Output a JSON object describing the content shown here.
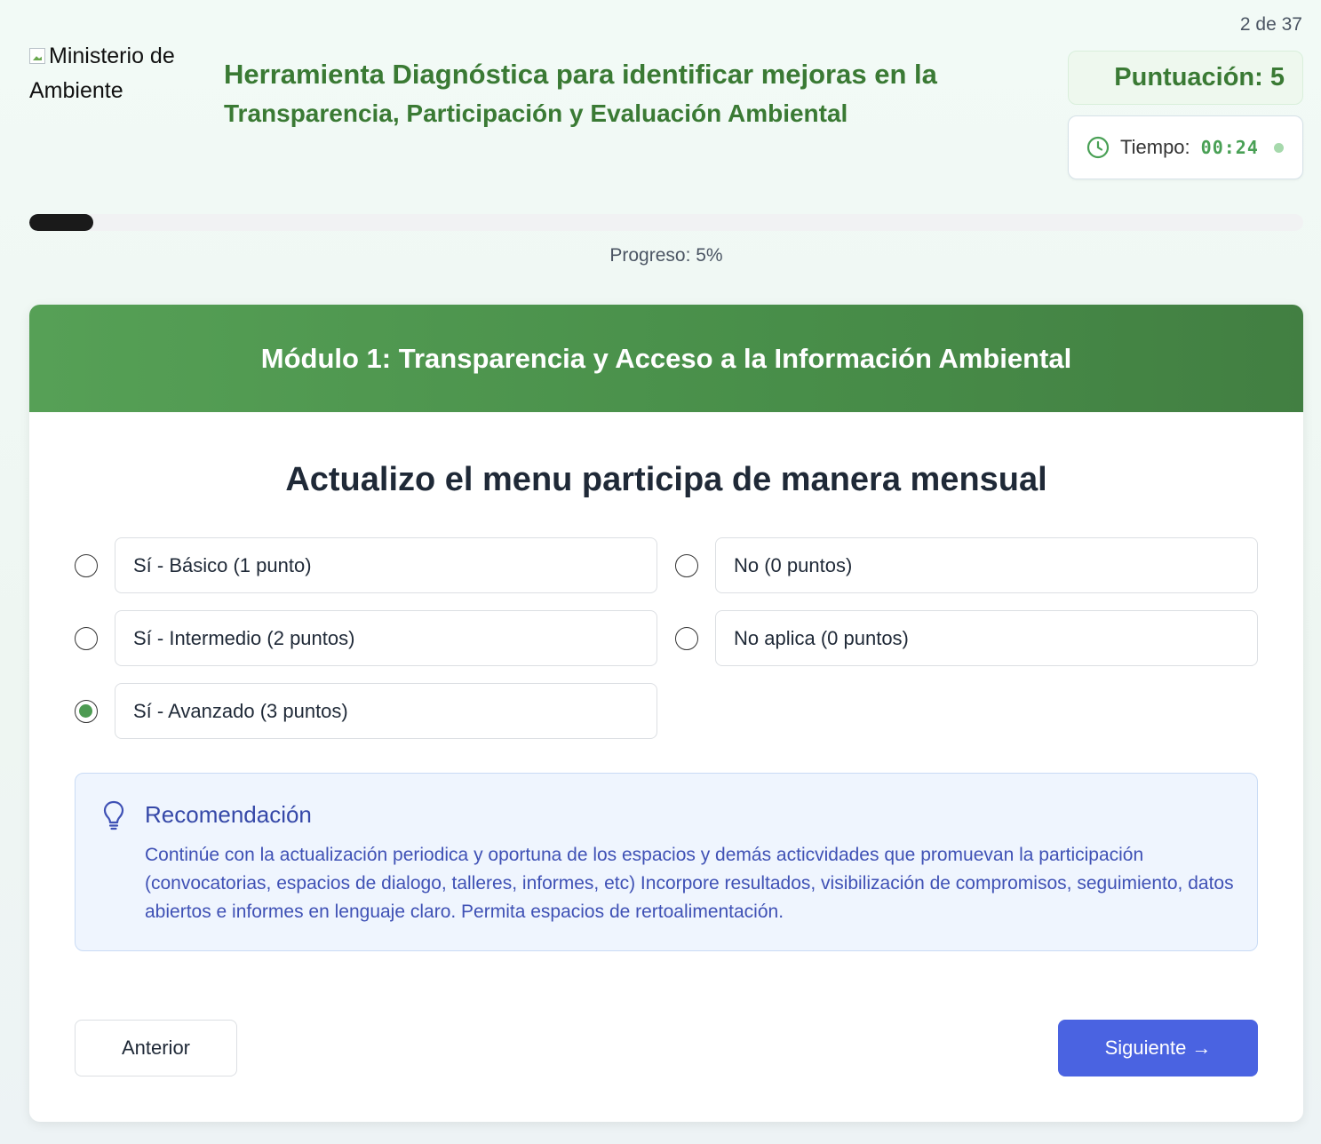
{
  "header": {
    "logo_alt": "Ministerio de Ambiente",
    "title_line1": "Herramienta Diagnóstica para identificar mejoras en la",
    "title_line2": "Transparencia, Participación y Evaluación Ambiental",
    "page_counter": "2 de 37",
    "score_label": "Puntuación: 5",
    "timer_label": "Tiempo:",
    "timer_value": "00:24",
    "timer_icon": "clock-icon",
    "timer_status_icon": "status-dot-icon"
  },
  "progress": {
    "percent": 5,
    "label": "Progreso: 5%"
  },
  "module": {
    "title": "Módulo 1: Transparencia y Acceso a la Información Ambiental"
  },
  "question": {
    "text": "Actualizo el menu participa de manera mensual",
    "options": [
      {
        "label": "Sí - Básico (1 punto)",
        "checked": false
      },
      {
        "label": "No (0 puntos)",
        "checked": false
      },
      {
        "label": "Sí - Intermedio (2 puntos)",
        "checked": false
      },
      {
        "label": "No aplica (0 puntos)",
        "checked": false
      },
      {
        "label": "Sí - Avanzado (3 puntos)",
        "checked": true
      }
    ]
  },
  "recommendation": {
    "icon": "lightbulb-icon",
    "title": "Recomendación",
    "text": "Continúe con la actualización periodica y oportuna de los espacios y demás acticvidades que promuevan la participación (convocatorias, espacios de dialogo, talleres, informes, etc) Incorpore resultados, visibilización de compromisos, seguimiento, datos abiertos e informes en lenguaje claro. Permita espacios de rertoalimentación."
  },
  "nav": {
    "prev_label": "Anterior",
    "next_label": "Siguiente →"
  },
  "colors": {
    "brand_green": "#3a7a34",
    "header_green": "#4d9b52",
    "accent_blue": "#4a63e1",
    "reco_text": "#3f51b5"
  }
}
